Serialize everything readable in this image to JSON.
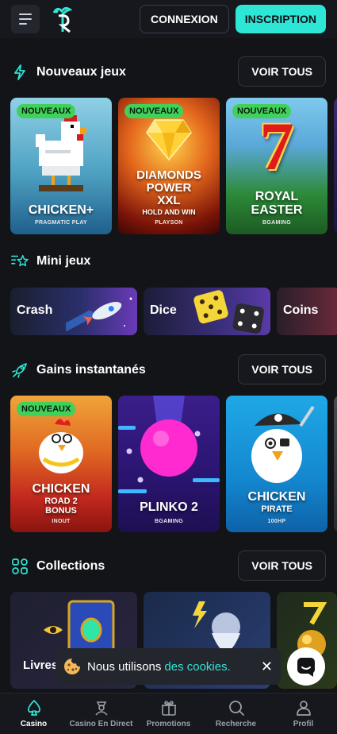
{
  "header": {
    "login_label": "CONNEXION",
    "signup_label": "INSCRIPTION"
  },
  "sections": {
    "new_games": {
      "title": "Nouveaux jeux",
      "see_all": "VOIR TOUS",
      "games": [
        {
          "badge": "NOUVEAUX",
          "title": "CHICKEN+",
          "provider": "PRAGMATIC PLAY"
        },
        {
          "badge": "NOUVEAUX",
          "title_lines": [
            "DIAMONDS",
            "POWER",
            "XXL"
          ],
          "subtitle": "HOLD AND WIN",
          "provider": "PLAYSON"
        },
        {
          "badge": "NOUVEAUX",
          "big": "7",
          "title_lines": [
            "ROYAL",
            "EASTER"
          ],
          "provider": "BGAMING"
        }
      ]
    },
    "mini_games": {
      "title": "Mini jeux",
      "items": [
        {
          "label": "Crash"
        },
        {
          "label": "Dice"
        },
        {
          "label": "Coins"
        }
      ]
    },
    "instant": {
      "title": "Gains instantanés",
      "see_all": "VOIR TOUS",
      "games": [
        {
          "badge": "NOUVEAUX",
          "title": "CHICKEN",
          "subtitle_lines": [
            "ROAD 2",
            "BONUS"
          ],
          "provider": "INOUT"
        },
        {
          "title": "PLINKO 2",
          "provider": "BGAMING"
        },
        {
          "title": "CHICKEN",
          "subtitle": "PIRATE",
          "provider": "100HP"
        }
      ]
    },
    "collections": {
      "title": "Collections",
      "see_all": "VOIR TOUS",
      "first_label": "Livres"
    }
  },
  "cookie": {
    "text": "Nous utilisons",
    "link": "des cookies.",
    "close": "✕"
  },
  "bottom_nav": [
    {
      "label": "Casino",
      "icon": "spade-icon",
      "active": true
    },
    {
      "label": "Casino En Direct",
      "icon": "dealer-icon",
      "active": false
    },
    {
      "label": "Promotions",
      "icon": "gift-icon",
      "active": false
    },
    {
      "label": "Recherche",
      "icon": "search-icon",
      "active": false
    },
    {
      "label": "Profil",
      "icon": "user-icon",
      "active": false
    }
  ],
  "colors": {
    "accent": "#2ee6d6",
    "badge": "#3fd15a",
    "background": "#121418"
  }
}
